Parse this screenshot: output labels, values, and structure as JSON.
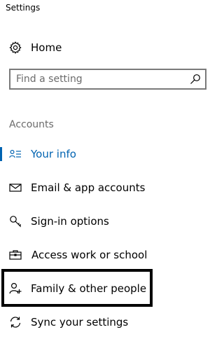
{
  "window": {
    "title": "Settings"
  },
  "nav": {
    "home_label": "Home"
  },
  "search": {
    "placeholder": "Find a setting",
    "value": ""
  },
  "section": {
    "header": "Accounts",
    "items": [
      {
        "label": "Your info",
        "icon": "person-info-icon",
        "active": true
      },
      {
        "label": "Email & app accounts",
        "icon": "mail-icon",
        "active": false
      },
      {
        "label": "Sign-in options",
        "icon": "key-icon",
        "active": false
      },
      {
        "label": "Access work or school",
        "icon": "briefcase-icon",
        "active": false
      },
      {
        "label": "Family & other people",
        "icon": "person-add-icon",
        "active": false,
        "focused": true
      },
      {
        "label": "Sync your settings",
        "icon": "sync-icon",
        "active": false
      }
    ]
  },
  "colors": {
    "accent": "#0063b1",
    "text": "#000000",
    "secondary_text": "#6b6b6b",
    "border": "#7a7a7a"
  }
}
